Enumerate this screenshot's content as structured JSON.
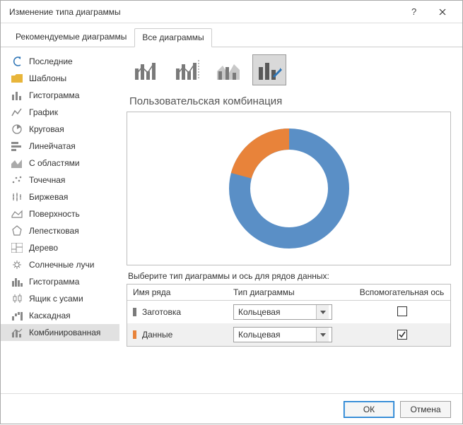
{
  "window": {
    "title": "Изменение типа диаграммы"
  },
  "tabs": {
    "recommended": "Рекомендуемые диаграммы",
    "all": "Все диаграммы"
  },
  "sidebar": {
    "items": [
      "Последние",
      "Шаблоны",
      "Гистограмма",
      "График",
      "Круговая",
      "Линейчатая",
      "С областями",
      "Точечная",
      "Биржевая",
      "Поверхность",
      "Лепестковая",
      "Дерево",
      "Солнечные лучи",
      "Гистограмма",
      "Ящик с усами",
      "Каскадная",
      "Комбинированная"
    ]
  },
  "content": {
    "subtitle": "Пользовательская комбинация",
    "help": "Выберите тип диаграммы и ось для рядов данных:",
    "headers": {
      "name": "Имя ряда",
      "type": "Тип диаграммы",
      "aux": "Вспомогательная ось"
    },
    "rows": [
      {
        "name": "Заготовка",
        "type": "Кольцевая",
        "aux": false,
        "color": "#7a7a7a"
      },
      {
        "name": "Данные",
        "type": "Кольцевая",
        "aux": true,
        "color": "#e8833a"
      }
    ]
  },
  "chart_data": {
    "type": "pie",
    "title": "",
    "series": [
      {
        "name": "Данные",
        "value": 28,
        "color": "#e8833a"
      },
      {
        "name": "Заготовка",
        "value": 72,
        "color": "#5a8fc6"
      }
    ],
    "donut_hole": 0.58
  },
  "buttons": {
    "ok": "ОК",
    "cancel": "Отмена"
  }
}
